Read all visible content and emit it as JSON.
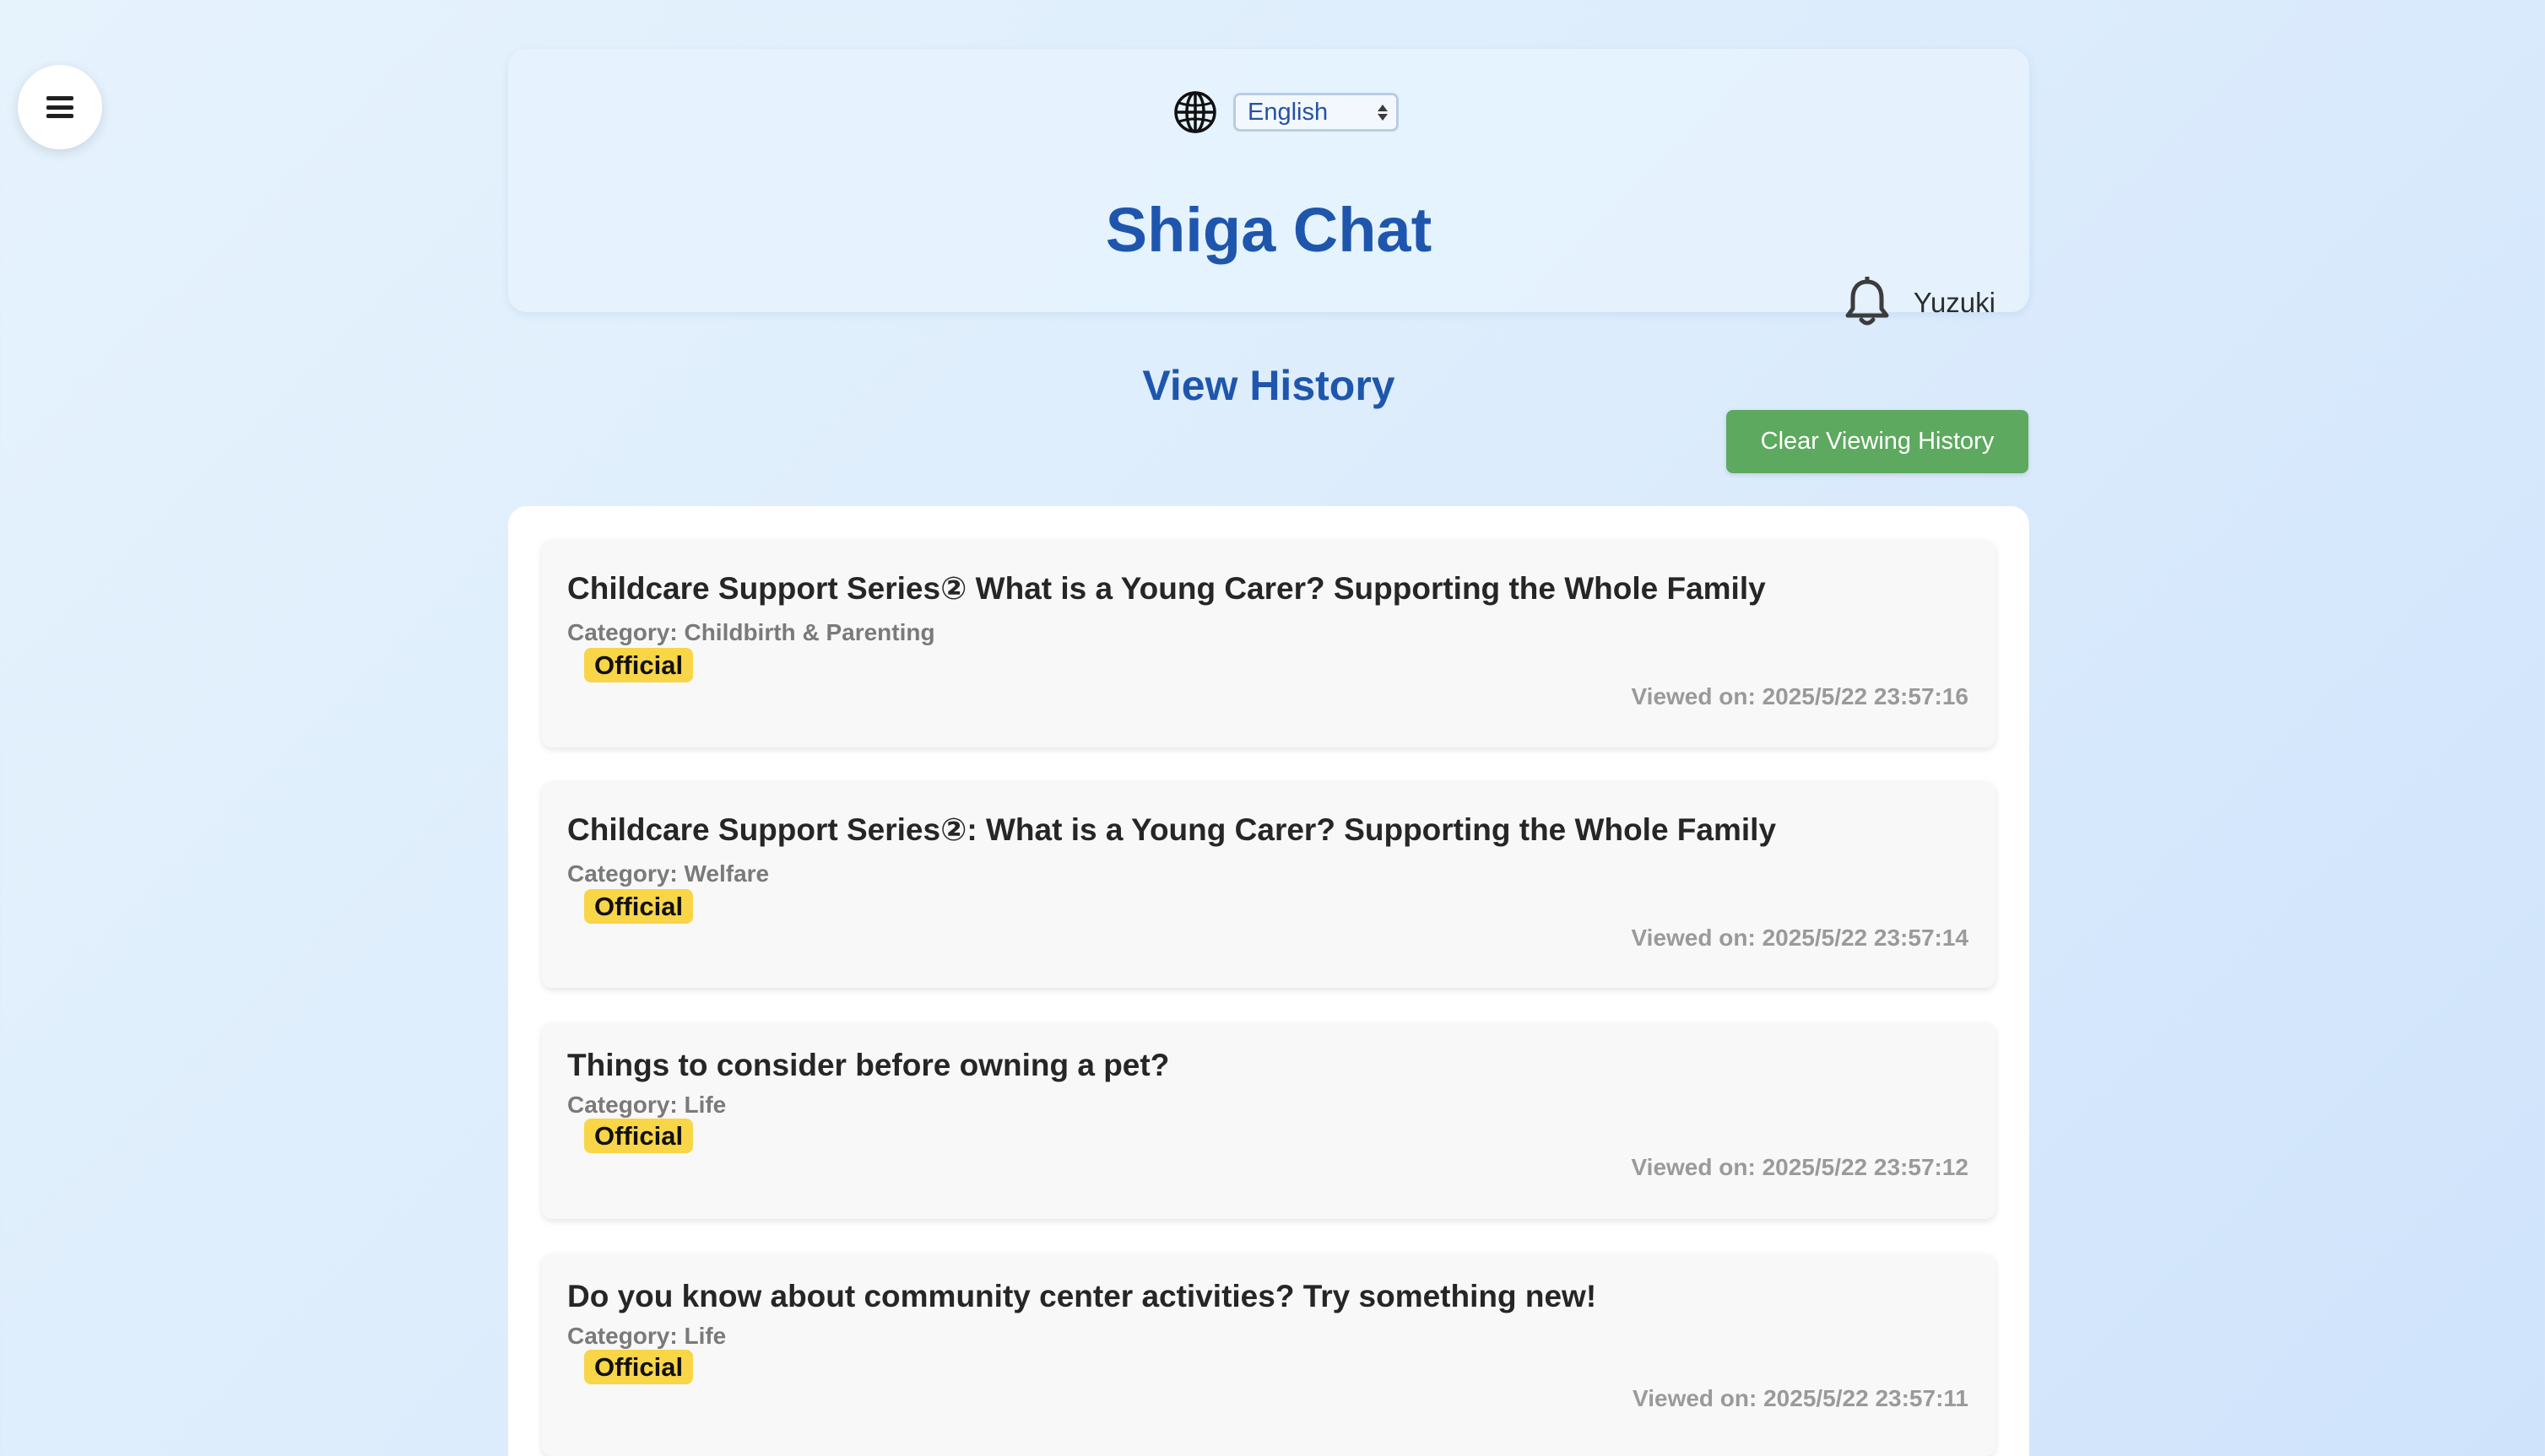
{
  "header": {
    "language_selected": "English",
    "app_title": "Shiga Chat",
    "username": "Yuzuki"
  },
  "page": {
    "title": "View History",
    "clear_button": "Clear Viewing History"
  },
  "history": [
    {
      "title": "Childcare Support Series② What is a Young Carer? Supporting the Whole Family",
      "category": "Category: Childbirth & Parenting",
      "badge": "Official",
      "viewed": "Viewed on: 2025/5/22 23:57:16"
    },
    {
      "title": "Childcare Support Series②: What is a Young Carer? Supporting the Whole Family",
      "category": "Category: Welfare",
      "badge": "Official",
      "viewed": "Viewed on: 2025/5/22 23:57:14"
    },
    {
      "title": "Things to consider before owning a pet?",
      "category": "Category: Life",
      "badge": "Official",
      "viewed": "Viewed on: 2025/5/22 23:57:12"
    },
    {
      "title": "Do you know about community center activities? Try something new!",
      "category": "Category: Life",
      "badge": "Official",
      "viewed": "Viewed on: 2025/5/22 23:57:11"
    }
  ],
  "icons": {
    "menu": "hamburger-menu-icon",
    "language": "globe-icon",
    "notifications": "bell-icon"
  },
  "colors": {
    "title_blue": "#1f56ad",
    "clear_button_green": "#5da95f",
    "official_badge_yellow": "#f9d548"
  }
}
